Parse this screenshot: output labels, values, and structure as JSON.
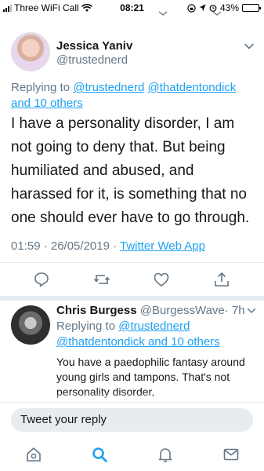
{
  "status_bar": {
    "carrier": "Three WiFi Call",
    "time": "08:21",
    "battery": "43%",
    "battery_level": 0.43
  },
  "main_tweet": {
    "author_name": "Jessica Yaniv",
    "author_handle": "@trustednerd",
    "replying_prefix": "Replying to",
    "replying_mention_1": "@trustednerd",
    "replying_mention_2": "@thatdentondick",
    "replying_others": "and 10 others",
    "text": "I have a personality disorder, I am not going to deny that. But being humiliated and abused, and harassed for it, is something that no one should ever have to go through.",
    "timestamp": "01:59 · 26/05/2019 ·",
    "source_app": "Twitter Web App"
  },
  "reply_tweet": {
    "author_name": "Chris Burgess",
    "author_handle": "@BurgessWave",
    "time_ago": "· 7h",
    "replying_prefix": "Replying to",
    "replying_mention_1": "@trustednerd",
    "replying_mention_2": "@thatdentondick and 10 others",
    "text": "You have a paedophilic fantasy around young girls and tampons. That's not personality disorder,"
  },
  "compose": {
    "placeholder": "Tweet your reply"
  },
  "colors": {
    "accent": "#1da1f2",
    "secondary_text": "#657786",
    "primary_text": "#14171a",
    "divider": "#e6ecf0"
  },
  "icons": {
    "actions": [
      "reply-icon",
      "retweet-icon",
      "like-icon",
      "share-icon"
    ],
    "nav": [
      "home-icon",
      "search-icon",
      "notifications-icon",
      "messages-icon"
    ]
  }
}
